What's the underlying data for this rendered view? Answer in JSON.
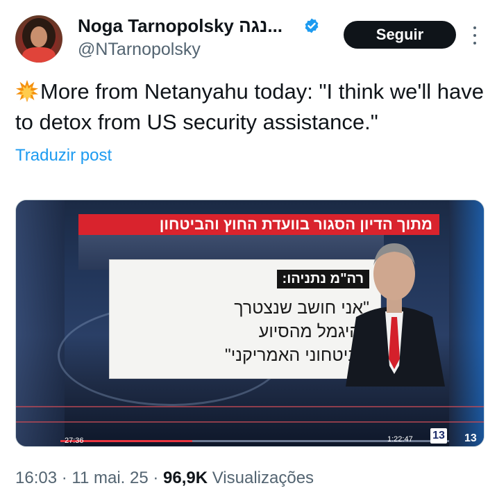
{
  "author": {
    "display_name": "Noga Tarnopolsky נגה...",
    "handle": "@NTarnopolsky",
    "verified_icon": "verified-badge-icon",
    "avatar_icon": "avatar"
  },
  "actions": {
    "follow_label": "Seguir",
    "more_icon": "more-vertical-icon"
  },
  "tweet": {
    "emoji": "collision-emoji",
    "text": "More from Netanyahu today: \"I think we'll have to detox from US security assistance.\"",
    "translate_label": "Traduzir post"
  },
  "media": {
    "banner_text": "מתוך הדיון הסגור בוועדת החוץ והביטחון",
    "card_label": "רה\"מ נתניהו:",
    "quote_line1": "\"אני חושב שנצטרך",
    "quote_line2": "להיגמל מהסיוע",
    "quote_line3": "הביטחוני האמריקני\"",
    "elapsed_time": "27:36",
    "duration": "1:22:47",
    "logo_text": "13",
    "channel_number": "13",
    "progress_fraction": 0.34
  },
  "meta": {
    "time": "16:03",
    "sep1": " · ",
    "date": "11 mai. 25",
    "sep2": " · ",
    "views": "96,9K",
    "views_label": " Visualizações"
  },
  "colors": {
    "accent": "#1d9bf0",
    "text_primary": "#0f1419",
    "text_secondary": "#536471",
    "button_bg": "#0f1419"
  }
}
